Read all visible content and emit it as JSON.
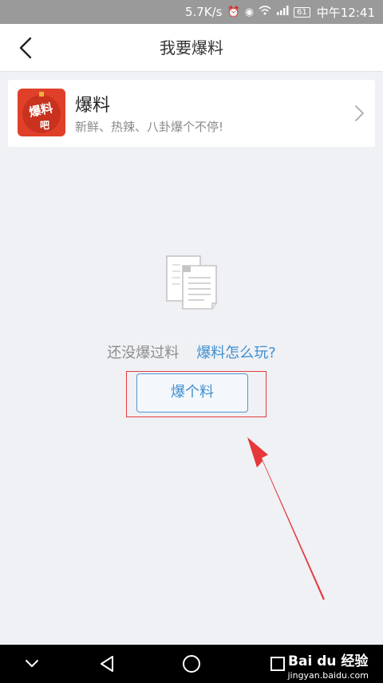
{
  "status_bar": {
    "speed": "5.7K/s",
    "battery": "61",
    "time": "中午12:41",
    "icons": [
      "alarm-icon",
      "eye-icon",
      "wifi-icon",
      "signal-icon",
      "battery-icon"
    ]
  },
  "header": {
    "title": "我要爆料",
    "back_icon": "chevron-left-icon"
  },
  "card": {
    "logo_text": "爆料吧",
    "title": "爆料",
    "subtitle": "新鲜、热辣、八卦爆个不停!"
  },
  "empty_state": {
    "text": "还没爆过料",
    "link": "爆料怎么玩?",
    "button": "爆个料"
  },
  "colors": {
    "link": "#3f8fd1",
    "annotation": "#e23b3b",
    "logo_bg": "#e0402a"
  },
  "watermark": {
    "brand": "Bai du 经验",
    "url": "jingyan.baidu.com"
  }
}
